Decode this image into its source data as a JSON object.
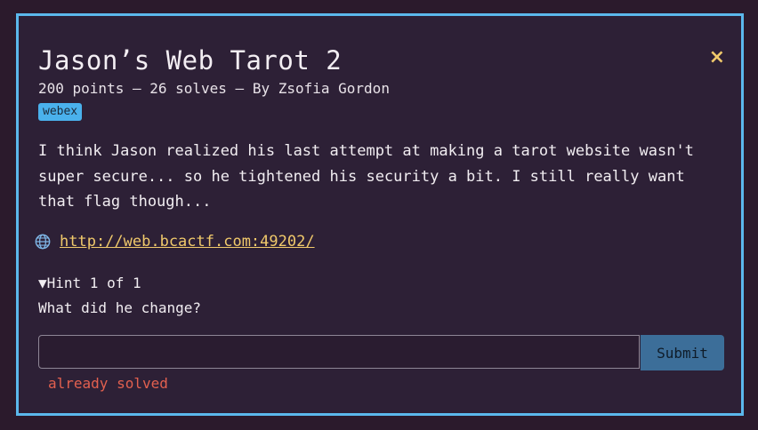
{
  "challenge": {
    "title": "Jason’s Web Tarot 2",
    "meta": "200 points – 26 solves – By Zsofia Gordon",
    "tag": "webex",
    "description": "I think Jason realized his last attempt at making a tarot website wasn't super secure... so he tightened his security a bit. I still really want that flag though...",
    "link": "http://web.bcactf.com:49202/",
    "hint_summary": "▼Hint 1 of 1",
    "hint_text": "What did he change?",
    "flag_value": "",
    "submit_label": "Submit",
    "status": "already solved",
    "close_icon": "×"
  },
  "icons": {
    "close": "close-icon",
    "link": "globe-icon"
  },
  "colors": {
    "border": "#5bb8ec",
    "accent": "#f0c96b",
    "tag": "#4ab1ec",
    "submit": "#3c6e99",
    "error": "#e2604f"
  }
}
